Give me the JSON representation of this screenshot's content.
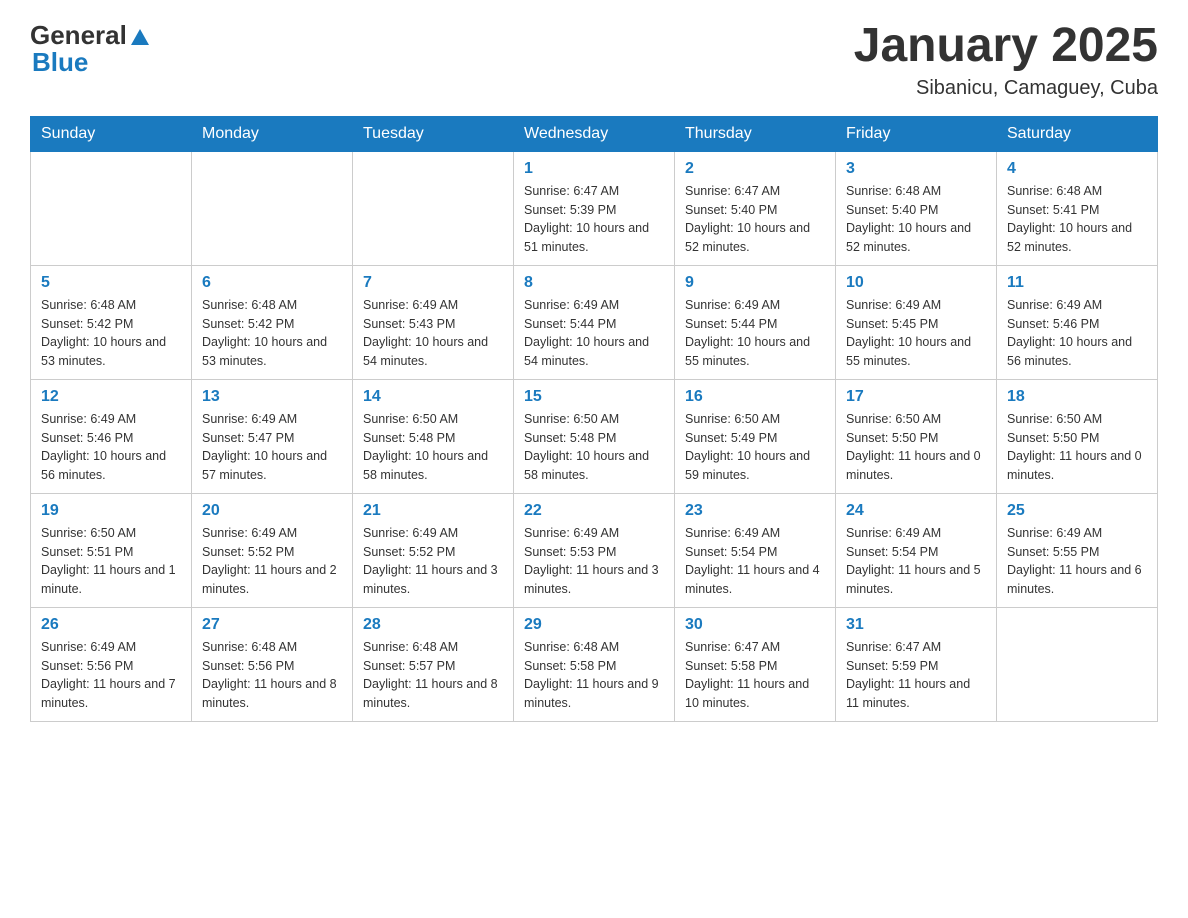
{
  "logo": {
    "text_general": "General",
    "text_blue": "Blue"
  },
  "header": {
    "title": "January 2025",
    "subtitle": "Sibanicu, Camaguey, Cuba"
  },
  "days_of_week": [
    "Sunday",
    "Monday",
    "Tuesday",
    "Wednesday",
    "Thursday",
    "Friday",
    "Saturday"
  ],
  "weeks": [
    [
      {
        "day": "",
        "info": ""
      },
      {
        "day": "",
        "info": ""
      },
      {
        "day": "",
        "info": ""
      },
      {
        "day": "1",
        "info": "Sunrise: 6:47 AM\nSunset: 5:39 PM\nDaylight: 10 hours and 51 minutes."
      },
      {
        "day": "2",
        "info": "Sunrise: 6:47 AM\nSunset: 5:40 PM\nDaylight: 10 hours and 52 minutes."
      },
      {
        "day": "3",
        "info": "Sunrise: 6:48 AM\nSunset: 5:40 PM\nDaylight: 10 hours and 52 minutes."
      },
      {
        "day": "4",
        "info": "Sunrise: 6:48 AM\nSunset: 5:41 PM\nDaylight: 10 hours and 52 minutes."
      }
    ],
    [
      {
        "day": "5",
        "info": "Sunrise: 6:48 AM\nSunset: 5:42 PM\nDaylight: 10 hours and 53 minutes."
      },
      {
        "day": "6",
        "info": "Sunrise: 6:48 AM\nSunset: 5:42 PM\nDaylight: 10 hours and 53 minutes."
      },
      {
        "day": "7",
        "info": "Sunrise: 6:49 AM\nSunset: 5:43 PM\nDaylight: 10 hours and 54 minutes."
      },
      {
        "day": "8",
        "info": "Sunrise: 6:49 AM\nSunset: 5:44 PM\nDaylight: 10 hours and 54 minutes."
      },
      {
        "day": "9",
        "info": "Sunrise: 6:49 AM\nSunset: 5:44 PM\nDaylight: 10 hours and 55 minutes."
      },
      {
        "day": "10",
        "info": "Sunrise: 6:49 AM\nSunset: 5:45 PM\nDaylight: 10 hours and 55 minutes."
      },
      {
        "day": "11",
        "info": "Sunrise: 6:49 AM\nSunset: 5:46 PM\nDaylight: 10 hours and 56 minutes."
      }
    ],
    [
      {
        "day": "12",
        "info": "Sunrise: 6:49 AM\nSunset: 5:46 PM\nDaylight: 10 hours and 56 minutes."
      },
      {
        "day": "13",
        "info": "Sunrise: 6:49 AM\nSunset: 5:47 PM\nDaylight: 10 hours and 57 minutes."
      },
      {
        "day": "14",
        "info": "Sunrise: 6:50 AM\nSunset: 5:48 PM\nDaylight: 10 hours and 58 minutes."
      },
      {
        "day": "15",
        "info": "Sunrise: 6:50 AM\nSunset: 5:48 PM\nDaylight: 10 hours and 58 minutes."
      },
      {
        "day": "16",
        "info": "Sunrise: 6:50 AM\nSunset: 5:49 PM\nDaylight: 10 hours and 59 minutes."
      },
      {
        "day": "17",
        "info": "Sunrise: 6:50 AM\nSunset: 5:50 PM\nDaylight: 11 hours and 0 minutes."
      },
      {
        "day": "18",
        "info": "Sunrise: 6:50 AM\nSunset: 5:50 PM\nDaylight: 11 hours and 0 minutes."
      }
    ],
    [
      {
        "day": "19",
        "info": "Sunrise: 6:50 AM\nSunset: 5:51 PM\nDaylight: 11 hours and 1 minute."
      },
      {
        "day": "20",
        "info": "Sunrise: 6:49 AM\nSunset: 5:52 PM\nDaylight: 11 hours and 2 minutes."
      },
      {
        "day": "21",
        "info": "Sunrise: 6:49 AM\nSunset: 5:52 PM\nDaylight: 11 hours and 3 minutes."
      },
      {
        "day": "22",
        "info": "Sunrise: 6:49 AM\nSunset: 5:53 PM\nDaylight: 11 hours and 3 minutes."
      },
      {
        "day": "23",
        "info": "Sunrise: 6:49 AM\nSunset: 5:54 PM\nDaylight: 11 hours and 4 minutes."
      },
      {
        "day": "24",
        "info": "Sunrise: 6:49 AM\nSunset: 5:54 PM\nDaylight: 11 hours and 5 minutes."
      },
      {
        "day": "25",
        "info": "Sunrise: 6:49 AM\nSunset: 5:55 PM\nDaylight: 11 hours and 6 minutes."
      }
    ],
    [
      {
        "day": "26",
        "info": "Sunrise: 6:49 AM\nSunset: 5:56 PM\nDaylight: 11 hours and 7 minutes."
      },
      {
        "day": "27",
        "info": "Sunrise: 6:48 AM\nSunset: 5:56 PM\nDaylight: 11 hours and 8 minutes."
      },
      {
        "day": "28",
        "info": "Sunrise: 6:48 AM\nSunset: 5:57 PM\nDaylight: 11 hours and 8 minutes."
      },
      {
        "day": "29",
        "info": "Sunrise: 6:48 AM\nSunset: 5:58 PM\nDaylight: 11 hours and 9 minutes."
      },
      {
        "day": "30",
        "info": "Sunrise: 6:47 AM\nSunset: 5:58 PM\nDaylight: 11 hours and 10 minutes."
      },
      {
        "day": "31",
        "info": "Sunrise: 6:47 AM\nSunset: 5:59 PM\nDaylight: 11 hours and 11 minutes."
      },
      {
        "day": "",
        "info": ""
      }
    ]
  ]
}
